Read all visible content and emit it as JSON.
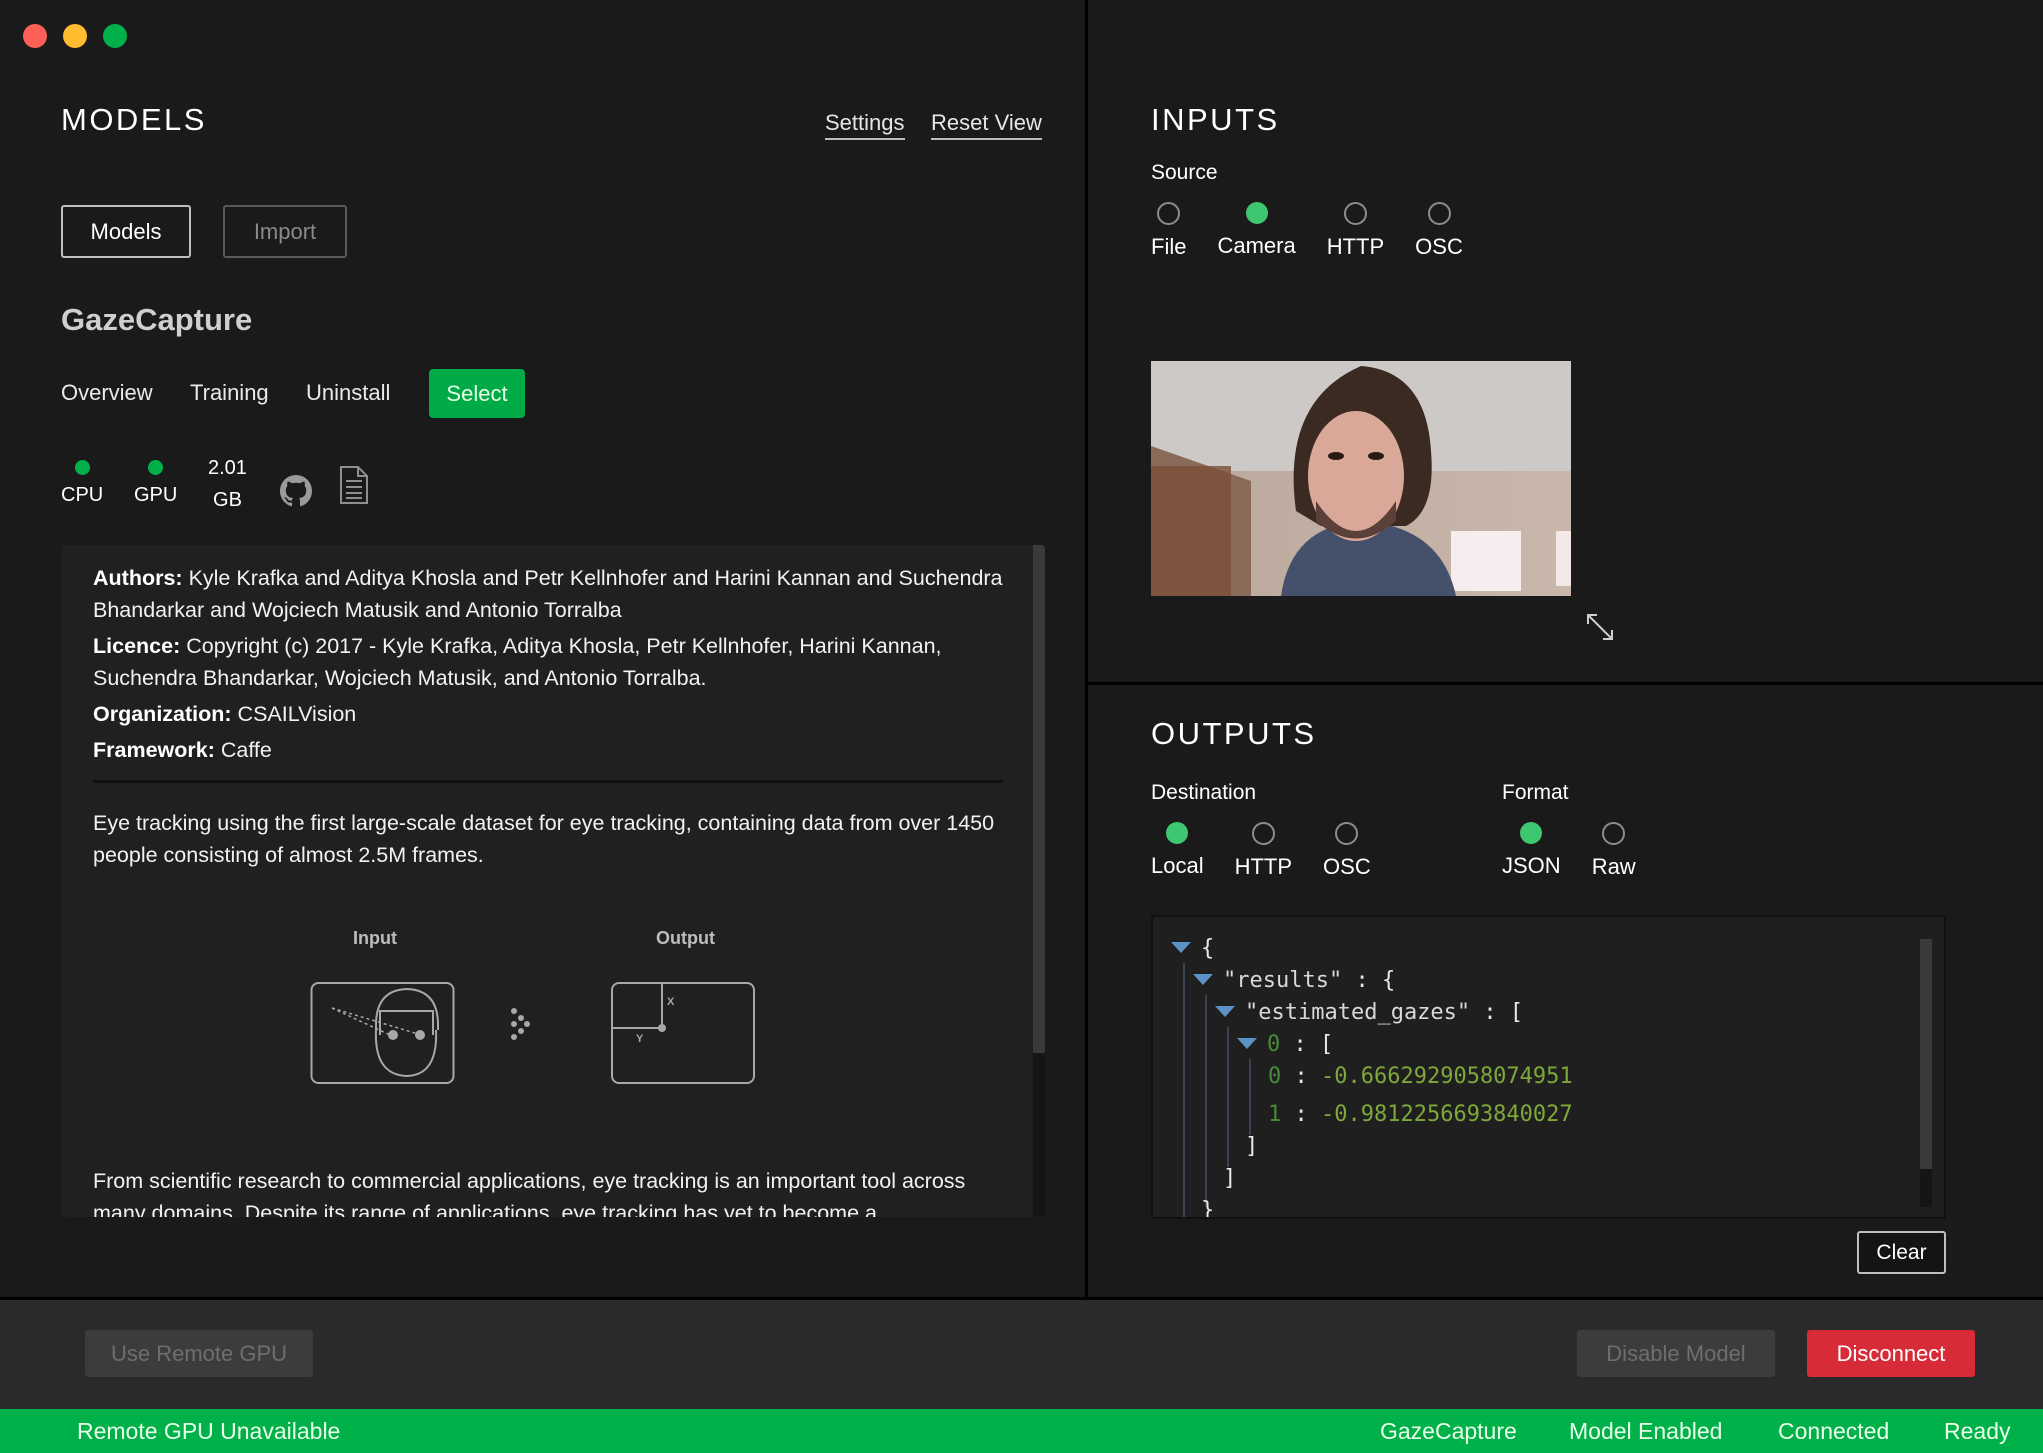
{
  "window": {
    "controls": [
      "close",
      "minimize",
      "maximize"
    ]
  },
  "models_panel": {
    "title": "MODELS",
    "links": {
      "settings": "Settings",
      "reset_view": "Reset View"
    },
    "buttons": {
      "models": "Models",
      "import": "Import"
    },
    "model": {
      "name": "GazeCapture",
      "tabs": [
        "Overview",
        "Training",
        "Uninstall"
      ],
      "select_label": "Select",
      "stats": {
        "cpu": "CPU",
        "gpu": "GPU",
        "size_value": "2.01",
        "size_unit": "GB"
      },
      "icons": [
        "github-icon",
        "document-icon"
      ],
      "description": {
        "authors_label": "Authors:",
        "authors": "Kyle Krafka and Aditya Khosla and Petr Kellnhofer and Harini Kannan and Suchendra Bhandarkar and Wojciech Matusik and Antonio Torralba",
        "licence_label": "Licence:",
        "licence": "Copyright (c) 2017 - Kyle Krafka, Aditya Khosla, Petr Kellnhofer, Harini Kannan, Suchendra Bhandarkar, Wojciech Matusik, and Antonio Torralba.",
        "organization_label": "Organization:",
        "organization": "CSAILVision",
        "framework_label": "Framework:",
        "framework": "Caffe",
        "summary": "Eye tracking using the first large-scale dataset for eye tracking, containing data from over 1450 people consisting of almost 2.5M frames.",
        "diagram": {
          "input_label": "Input",
          "output_label": "Output",
          "x_label": "X",
          "y_label": "Y"
        },
        "body": "From scientific research to commercial applications, eye tracking is an important tool across many domains. Despite its range of applications, eye tracking has yet to become a"
      }
    }
  },
  "inputs_panel": {
    "title": "INPUTS",
    "source_label": "Source",
    "sources": [
      {
        "label": "File",
        "selected": false
      },
      {
        "label": "Camera",
        "selected": true
      },
      {
        "label": "HTTP",
        "selected": false
      },
      {
        "label": "OSC",
        "selected": false
      }
    ]
  },
  "outputs_panel": {
    "title": "OUTPUTS",
    "destination_label": "Destination",
    "destinations": [
      {
        "label": "Local",
        "selected": true
      },
      {
        "label": "HTTP",
        "selected": false
      },
      {
        "label": "OSC",
        "selected": false
      }
    ],
    "format_label": "Format",
    "formats": [
      {
        "label": "JSON",
        "selected": true
      },
      {
        "label": "Raw",
        "selected": false
      }
    ],
    "json_view": {
      "open_brace": "{",
      "results_key": "\"results\"",
      "gazes_key": "\"estimated_gazes\"",
      "index_0": "0",
      "values": [
        {
          "index": "0",
          "value": "-0.6662929058074951"
        },
        {
          "index": "1",
          "value": "-0.9812256693840027"
        }
      ]
    },
    "clear_label": "Clear"
  },
  "bottom_bar": {
    "use_remote_gpu": "Use Remote GPU",
    "disable_model": "Disable Model",
    "disconnect": "Disconnect"
  },
  "status_bar": {
    "remote_gpu": "Remote GPU Unavailable",
    "model": "GazeCapture",
    "model_state": "Model Enabled",
    "connection": "Connected",
    "state": "Ready"
  },
  "colors": {
    "accent_green": "#00b14a",
    "radio_selected": "#3ec670",
    "danger_red": "#d72b38",
    "json_number": "#7fa83a"
  }
}
